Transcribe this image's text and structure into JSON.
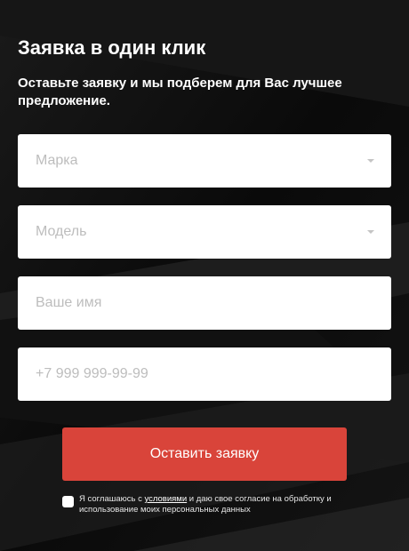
{
  "form": {
    "title": "Заявка в один клик",
    "subtitle": "Оставьте заявку и мы подберем для Вас лучшее предложение.",
    "fields": [
      {
        "placeholder": "Марка",
        "type": "select"
      },
      {
        "placeholder": "Модель",
        "type": "select"
      },
      {
        "placeholder": "Ваше имя",
        "type": "text"
      },
      {
        "placeholder": "+7 999 999-99-99",
        "type": "tel"
      }
    ],
    "submit_label": "Оставить заявку",
    "consent": {
      "checked": false,
      "text_before": "Я соглашаюсь с ",
      "link_text": "условиями",
      "text_after": " и даю свое согласие на обработку и использование моих персональных данных"
    }
  },
  "colors": {
    "background": "#0c0c0c",
    "accent": "#d9443a",
    "field": "#ffffff",
    "placeholder": "#bdbdbd"
  },
  "icons": {
    "dropdown": "caret-down-icon"
  }
}
